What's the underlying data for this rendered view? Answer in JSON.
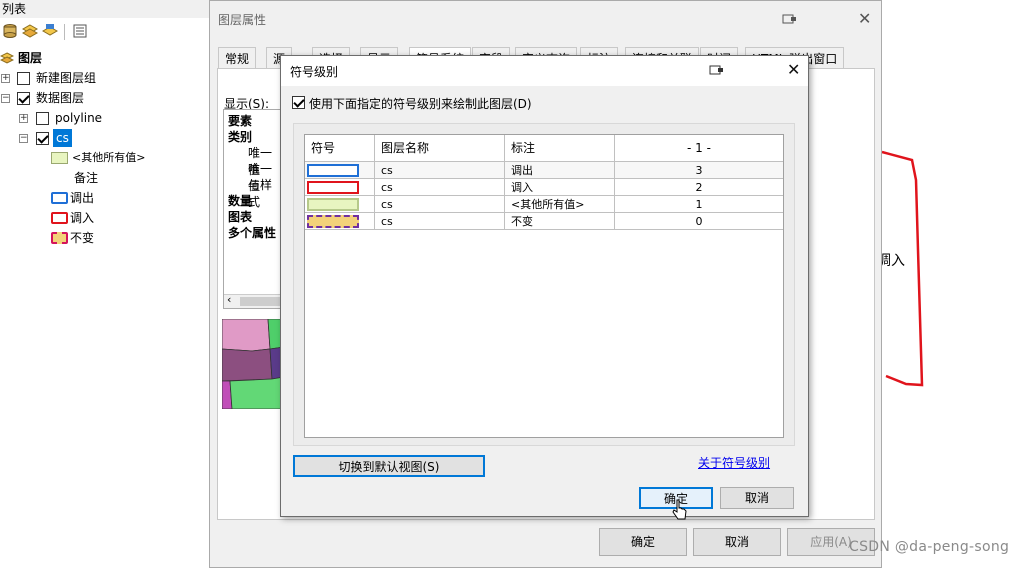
{
  "toc": {
    "title": "列表",
    "root_label": "图层",
    "items": [
      {
        "label": "新建图层组",
        "checked": false,
        "expander": "+"
      },
      {
        "label": "数据图层",
        "checked": true,
        "expander": "-"
      },
      {
        "label": "polyline",
        "checked": false,
        "expander": "+"
      },
      {
        "label": "cs",
        "checked": true,
        "expander": "-"
      }
    ],
    "legend": [
      {
        "label": "<其他所有值>",
        "color": "#e8f5c0"
      },
      {
        "label": "备注"
      },
      {
        "label": "调出",
        "color": "#1f6fd6"
      },
      {
        "label": "调入",
        "color": "#e0141c"
      },
      {
        "label": "不变",
        "color": "#d4145a"
      }
    ]
  },
  "layer_props": {
    "title": "图层属性",
    "tabs": [
      "常规",
      "源",
      "选择",
      "显示",
      "符号系统",
      "字段",
      "定义查询",
      "标注",
      "连接和关联",
      "时间",
      "HTML 弹出窗口"
    ],
    "display_label": "显示(S):",
    "tree": [
      "要素",
      "类别",
      "唯一值",
      "唯一值",
      "与样式",
      "数量",
      "图表",
      "多个属性"
    ],
    "ok": "确定",
    "cancel": "取消",
    "apply": "应用(A)"
  },
  "symbol_levels": {
    "title": "符号级别",
    "use_levels_label": "使用下面指定的符号级别来绘制此图层(D)",
    "use_levels_checked": true,
    "columns": [
      "符号",
      "图层名称",
      "标注",
      "- 1 -"
    ],
    "rows": [
      {
        "layer": "cs",
        "label": "调出",
        "level": "3",
        "stroke": "#1f6fd6",
        "fill": "#ffffff",
        "dash": false
      },
      {
        "layer": "cs",
        "label": "调入",
        "level": "2",
        "stroke": "#e0141c",
        "fill": "#ffffff",
        "dash": false
      },
      {
        "layer": "cs",
        "label": "<其他所有值>",
        "level": "1",
        "stroke": "#b6c98a",
        "fill": "#e8f5c0",
        "dash": false
      },
      {
        "layer": "cs",
        "label": "不变",
        "level": "0",
        "stroke": "#7030a0",
        "fill": "#f3d27a",
        "dash": true
      }
    ],
    "switch_view_label": "切换到默认视图(S)",
    "about_link": "关于符号级别",
    "ok": "确定",
    "cancel": "取消"
  },
  "map": {
    "label": "调入",
    "polygon_color": "#e0141c"
  },
  "watermark": "CSDN @da-peng-song"
}
